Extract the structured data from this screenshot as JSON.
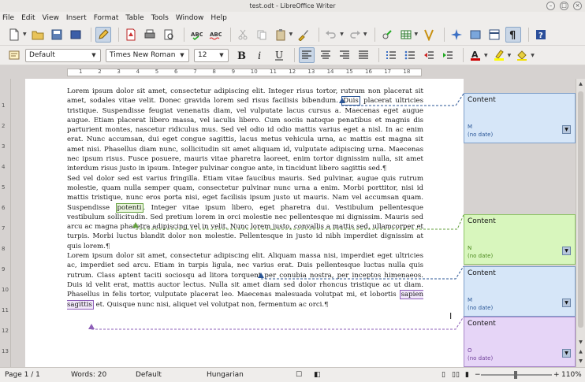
{
  "window": {
    "title": "test.odt - LibreOffice Writer"
  },
  "menubar": [
    "File",
    "Edit",
    "View",
    "Insert",
    "Format",
    "Table",
    "Tools",
    "Window",
    "Help"
  ],
  "formatting": {
    "paragraph_style": "Default",
    "font_name": "Times New Roman",
    "font_size": "12"
  },
  "hruler_ticks": [
    "1",
    "2",
    "3",
    "4",
    "5",
    "6",
    "7",
    "8",
    "9",
    "10",
    "11",
    "12",
    "13",
    "14",
    "15",
    "16",
    "17",
    "18"
  ],
  "vruler_ticks": [
    "1",
    "2",
    "3",
    "4",
    "5",
    "6",
    "7",
    "8",
    "9",
    "10",
    "11",
    "12",
    "13"
  ],
  "document": {
    "p1": {
      "before": "Lorem ipsum dolor sit amet, consectetur adipiscing elit. Integer risus tortor, rutrum non placerat sit amet, sodales vitae velit. Donec gravida lorem sed risus facilisis bibendum. ",
      "anchor": "Duis",
      "after": " placerat ultricies tristique. Suspendisse feugiat venenatis diam, vel vulputate lacus cursus a. Maecenas eget augue augue. Etiam placerat libero massa, vel iaculis libero. Cum sociis natoque penatibus et magnis dis parturient montes, nascetur ridiculus mus. Sed vel odio id odio mattis varius eget a nisl. In ac enim erat. Nunc accumsan, dui eget congue sagittis, lacus metus vehicula urna, ac mattis est magna sit amet nisi. Phasellus diam nunc, sollicitudin sit amet aliquam id, vulputate adipiscing urna. Maecenas nec ipsum risus. Fusce posuere, mauris vitae pharetra laoreet, enim tortor dignissim nulla, sit amet interdum risus justo in ipsum. Integer pulvinar congue ante, in tincidunt libero sagittis sed."
    },
    "p2": {
      "before": "Sed vel dolor sed est varius fringilla. Etiam vitae faucibus mauris. Sed pulvinar, augue quis rutrum molestie, quam nulla semper quam, consectetur pulvinar nunc urna a enim. Morbi porttitor, nisi id mattis tristique, nunc eros porta nisi, eget facilisis ipsum justo ut mauris. Nam vel accumsan quam. Suspendisse ",
      "anchor": "potenti",
      "after": ". Integer vitae ipsum libero, eget pharetra dui. Vestibulum pellentesque vestibulum sollicitudin. Sed pretium lorem in orci molestie nec pellentesque mi dignissim. Mauris sed arcu ac magna pharetra adipiscing vel in velit. Nunc lorem justo, convallis a mattis sed, ullamcorper et turpis. Morbi luctus blandit dolor non molestie. Pellentesque in justo id nibh imperdiet dignissim at quis lorem."
    },
    "p3": {
      "before": "Lorem ipsum dolor sit amet, consectetur adipiscing elit. Aliquam massa nisi, imperdiet eget ultricies ac, imperdiet sed arcu. Etiam in turpis ligula, nec varius erat. Duis pellentesque luctus nulla quis rutrum. Class aptent taciti sociosqu ad litora torquent per conubia nostra, per inceptos himenaeos. Duis id velit erat, mattis auctor lectus. Nulla sit amet diam sed dolor rhoncus tristique ac ut diam. Phasellus in felis tortor, vulputate placerat leo. Maecenas malesuada volutpat mi, et lobortis ",
      "anchor": "sapien sagittis",
      "after": " et. Quisque nunc nisi, aliquet vel volutpat non, fermentum ac orci."
    },
    "pilcrow": "¶"
  },
  "comments": [
    {
      "text": "Content",
      "author": "M",
      "date": "(no date)",
      "color": "#d6e6f8"
    },
    {
      "text": "Content",
      "author": "N",
      "date": "(no date)",
      "color": "#d8f6bd"
    },
    {
      "text": "Content",
      "author": "M",
      "date": "(no date)",
      "color": "#d6e6f8"
    },
    {
      "text": "Content",
      "author": "O",
      "date": "(no date)",
      "color": "#e6d5f7"
    }
  ],
  "comment_menu_glyph": "▼",
  "status": {
    "page": "Page 1 / 1",
    "words": "Words: 20",
    "style": "Default",
    "language": "Hungarian",
    "zoom": "110%"
  }
}
